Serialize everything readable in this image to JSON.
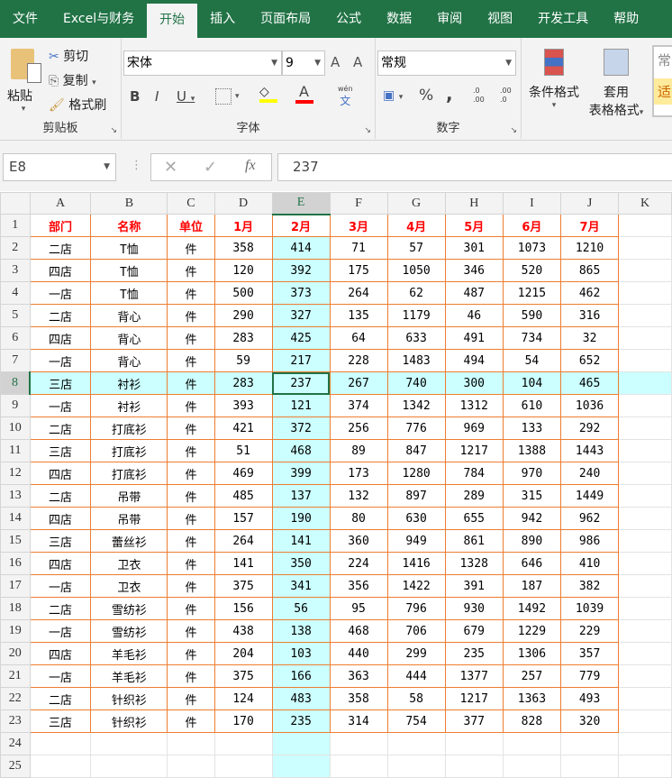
{
  "tabs": [
    "文件",
    "Excel与财务",
    "开始",
    "插入",
    "页面布局",
    "公式",
    "数据",
    "审阅",
    "视图",
    "开发工具",
    "帮助"
  ],
  "active_tab": "开始",
  "clipboard": {
    "paste": "粘贴",
    "cut": "剪切",
    "copy": "复制",
    "format_painter": "格式刷",
    "label": "剪贴板"
  },
  "font": {
    "name": "宋体",
    "size": "9",
    "label": "字体",
    "bold": "B",
    "italic": "I",
    "underline": "U",
    "phonetic": "wén",
    "phonetic_char": "文",
    "grow": "A",
    "shrink": "A",
    "font_color": "A"
  },
  "number": {
    "format": "常规",
    "label": "数字",
    "percent": "%",
    "comma": ",",
    "inc_decimal": ".0\n.00",
    "dec_decimal": ".00\n.0"
  },
  "styles": {
    "conditional": "条件格式",
    "table_format_1": "套用",
    "table_format_2": "表格格式",
    "cell_style_1": "常",
    "cell_style_2": "适"
  },
  "formula_bar": {
    "name_box": "E8",
    "value": "237",
    "fx": "fx"
  },
  "colors": {
    "accent": "#217346",
    "border": "#ed7d31",
    "highlight": "#ccffff",
    "header_text": "#ff0000"
  },
  "sheet": {
    "columns": [
      "A",
      "B",
      "C",
      "D",
      "E",
      "F",
      "G",
      "H",
      "I",
      "J",
      "K"
    ],
    "selected_cell": "E8",
    "header": [
      "部门",
      "名称",
      "单位",
      "1月",
      "2月",
      "3月",
      "4月",
      "5月",
      "6月",
      "7月"
    ],
    "rows": [
      [
        "二店",
        "T恤",
        "件",
        "358",
        "414",
        "71",
        "57",
        "301",
        "1073",
        "1210"
      ],
      [
        "四店",
        "T恤",
        "件",
        "120",
        "392",
        "175",
        "1050",
        "346",
        "520",
        "865"
      ],
      [
        "一店",
        "T恤",
        "件",
        "500",
        "373",
        "264",
        "62",
        "487",
        "1215",
        "462"
      ],
      [
        "二店",
        "背心",
        "件",
        "290",
        "327",
        "135",
        "1179",
        "46",
        "590",
        "316"
      ],
      [
        "四店",
        "背心",
        "件",
        "283",
        "425",
        "64",
        "633",
        "491",
        "734",
        "32"
      ],
      [
        "一店",
        "背心",
        "件",
        "59",
        "217",
        "228",
        "1483",
        "494",
        "54",
        "652"
      ],
      [
        "三店",
        "衬衫",
        "件",
        "283",
        "237",
        "267",
        "740",
        "300",
        "104",
        "465"
      ],
      [
        "一店",
        "衬衫",
        "件",
        "393",
        "121",
        "374",
        "1342",
        "1312",
        "610",
        "1036"
      ],
      [
        "二店",
        "打底衫",
        "件",
        "421",
        "372",
        "256",
        "776",
        "969",
        "133",
        "292"
      ],
      [
        "三店",
        "打底衫",
        "件",
        "51",
        "468",
        "89",
        "847",
        "1217",
        "1388",
        "1443"
      ],
      [
        "四店",
        "打底衫",
        "件",
        "469",
        "399",
        "173",
        "1280",
        "784",
        "970",
        "240"
      ],
      [
        "二店",
        "吊带",
        "件",
        "485",
        "137",
        "132",
        "897",
        "289",
        "315",
        "1449"
      ],
      [
        "四店",
        "吊带",
        "件",
        "157",
        "190",
        "80",
        "630",
        "655",
        "942",
        "962"
      ],
      [
        "三店",
        "蕾丝衫",
        "件",
        "264",
        "141",
        "360",
        "949",
        "861",
        "890",
        "986"
      ],
      [
        "四店",
        "卫衣",
        "件",
        "141",
        "350",
        "224",
        "1416",
        "1328",
        "646",
        "410"
      ],
      [
        "一店",
        "卫衣",
        "件",
        "375",
        "341",
        "356",
        "1422",
        "391",
        "187",
        "382"
      ],
      [
        "二店",
        "雪纺衫",
        "件",
        "156",
        "56",
        "95",
        "796",
        "930",
        "1492",
        "1039"
      ],
      [
        "一店",
        "雪纺衫",
        "件",
        "438",
        "138",
        "468",
        "706",
        "679",
        "1229",
        "229"
      ],
      [
        "四店",
        "羊毛衫",
        "件",
        "204",
        "103",
        "440",
        "299",
        "235",
        "1306",
        "357"
      ],
      [
        "一店",
        "羊毛衫",
        "件",
        "375",
        "166",
        "363",
        "444",
        "1377",
        "257",
        "779"
      ],
      [
        "二店",
        "针织衫",
        "件",
        "124",
        "483",
        "358",
        "58",
        "1217",
        "1363",
        "493"
      ],
      [
        "三店",
        "针织衫",
        "件",
        "170",
        "235",
        "314",
        "754",
        "377",
        "828",
        "320"
      ]
    ],
    "row_numbers": [
      "1",
      "2",
      "3",
      "4",
      "5",
      "6",
      "7",
      "8",
      "9",
      "10",
      "11",
      "12",
      "13",
      "14",
      "15",
      "16",
      "17",
      "18",
      "19",
      "20",
      "21",
      "22",
      "23",
      "24",
      "25"
    ]
  }
}
